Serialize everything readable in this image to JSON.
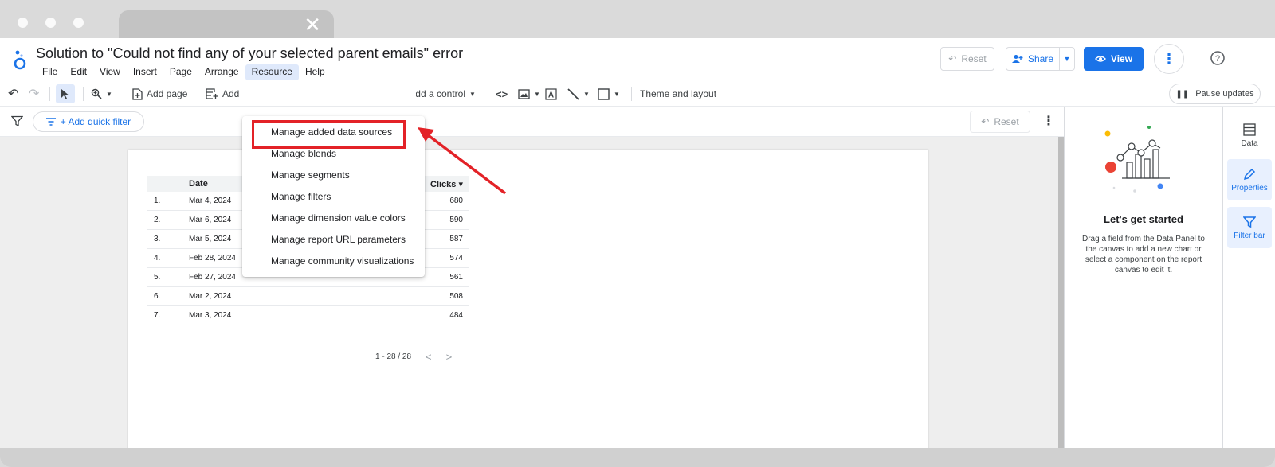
{
  "report": {
    "title": "Solution to \"Could not find any of your selected parent emails\" error"
  },
  "menu": [
    "File",
    "Edit",
    "View",
    "Insert",
    "Page",
    "Arrange",
    "Resource",
    "Help"
  ],
  "header": {
    "reset_label": "Reset",
    "share_label": "Share",
    "view_label": "View"
  },
  "toolbar": {
    "add_page_label": "Add page",
    "add_data_label": "Add",
    "add_control_label": "Add a control",
    "theme_label": "Theme and layout",
    "pause_label": "Pause updates"
  },
  "filterbar": {
    "quick_filter_label": "+ Add quick filter",
    "reset_label": "Reset"
  },
  "resource_menu": [
    "Manage added data sources",
    "Manage blends",
    "Manage segments",
    "Manage filters",
    "Manage dimension value colors",
    "Manage report URL parameters",
    "Manage community visualizations"
  ],
  "table": {
    "headers": {
      "date": "Date",
      "clicks": "Clicks ▾"
    },
    "rows": [
      {
        "idx": "1.",
        "date": "Mar 4, 2024",
        "clicks": "680"
      },
      {
        "idx": "2.",
        "date": "Mar 6, 2024",
        "clicks": "590"
      },
      {
        "idx": "3.",
        "date": "Mar 5, 2024",
        "clicks": "587"
      },
      {
        "idx": "4.",
        "date": "Feb 28, 2024",
        "clicks": "574"
      },
      {
        "idx": "5.",
        "date": "Feb 27, 2024",
        "clicks": "561"
      },
      {
        "idx": "6.",
        "date": "Mar 2, 2024",
        "clicks": "508"
      },
      {
        "idx": "7.",
        "date": "Mar 3, 2024",
        "clicks": "484"
      }
    ],
    "pager": "1 - 28 / 28"
  },
  "panel": {
    "title": "Let's get started",
    "description": "Drag a field from the Data Panel to the canvas to add a new chart or select a component on the report canvas to edit it."
  },
  "sidebar": {
    "data_label": "Data",
    "properties_label": "Properties",
    "filter_bar_label": "Filter bar"
  },
  "colors": {
    "accent": "#1a73e8",
    "annotation_red": "#e32227",
    "menu_active": "#dfe9fb"
  }
}
